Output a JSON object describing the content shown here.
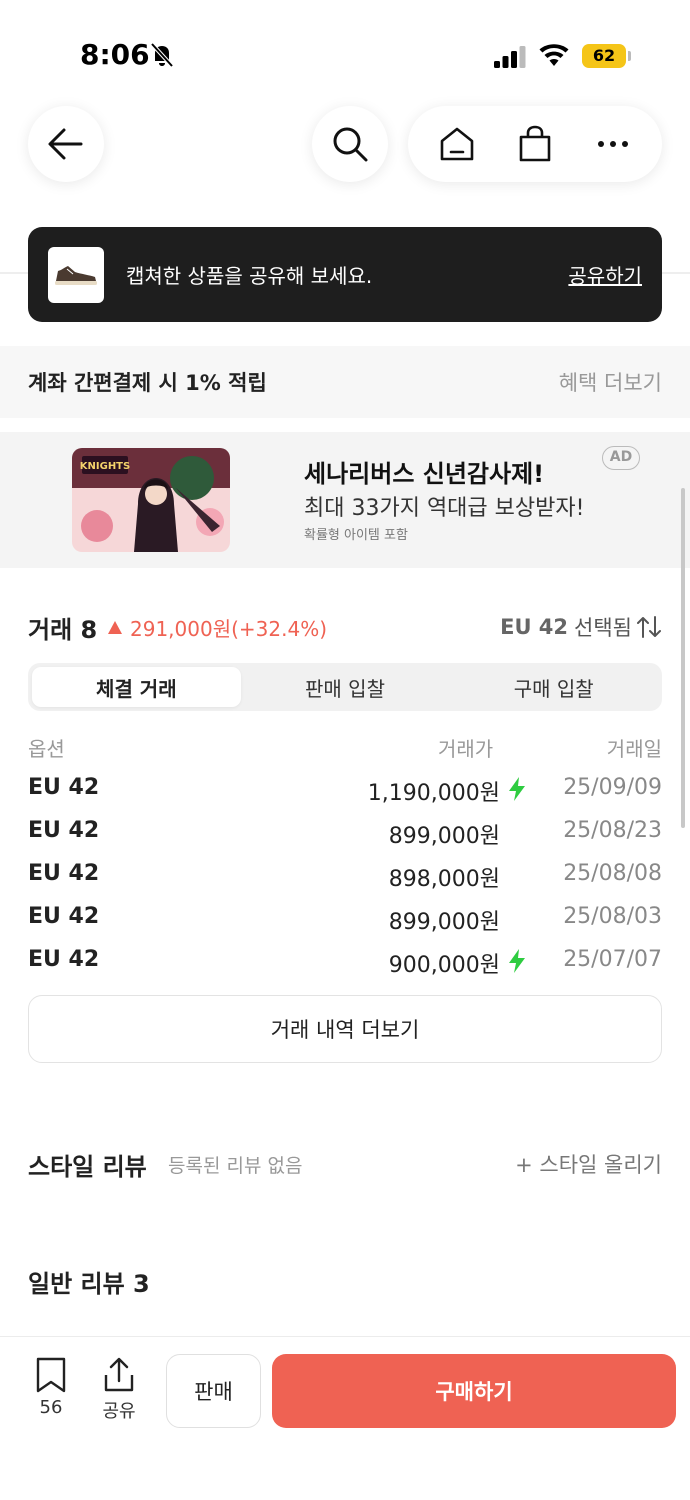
{
  "status_bar": {
    "time": "8:06",
    "battery": "62"
  },
  "toast": {
    "message": "캡쳐한 상품을 공유해 보세요.",
    "action": "공유하기"
  },
  "benefit": {
    "text": "계좌 간편결제 시 1% 적립",
    "link": "혜택 더보기"
  },
  "ad": {
    "title": "세나리버스 신년감사제!",
    "subtitle": "최대 33가지 역대급 보상받자!",
    "note": "확률형 아이템 포함",
    "badge": "AD",
    "image_text": "KNIGHTS"
  },
  "trades": {
    "title": "거래 8",
    "change": "291,000원(+32.4%)",
    "size_value": "EU 42",
    "size_suffix": "선택됨",
    "tabs": [
      "체결 거래",
      "판매 입찰",
      "구매 입찰"
    ],
    "active_tab": 0,
    "columns": {
      "option": "옵션",
      "price": "거래가",
      "date": "거래일"
    },
    "rows": [
      {
        "option": "EU 42",
        "price": "1,190,000원",
        "date": "25/09/09",
        "fast": true
      },
      {
        "option": "EU 42",
        "price": "899,000원",
        "date": "25/08/23",
        "fast": false
      },
      {
        "option": "EU 42",
        "price": "898,000원",
        "date": "25/08/08",
        "fast": false
      },
      {
        "option": "EU 42",
        "price": "899,000원",
        "date": "25/08/03",
        "fast": false
      },
      {
        "option": "EU 42",
        "price": "900,000원",
        "date": "25/07/07",
        "fast": true
      }
    ],
    "more_button": "거래 내역 더보기"
  },
  "style_review": {
    "title": "스타일 리뷰",
    "empty": "등록된 리뷰 없음",
    "upload": "+ 스타일 올리기"
  },
  "general_review": {
    "title": "일반 리뷰 3"
  },
  "bottom_bar": {
    "bookmark_count": "56",
    "share_label": "공유",
    "sell_label": "판매",
    "buy_label": "구매하기"
  },
  "colors": {
    "accent": "#ef6253",
    "bolt": "#2ecc40",
    "toast_bg": "#1e1e1e",
    "battery": "#f5c518"
  },
  "icons": [
    "bell-slash-icon",
    "signal-icon",
    "wifi-icon",
    "back-arrow-icon",
    "search-icon",
    "home-icon",
    "shopping-bag-icon",
    "more-icon",
    "bookmark-icon",
    "share-icon",
    "bolt-icon",
    "sort-icon"
  ]
}
